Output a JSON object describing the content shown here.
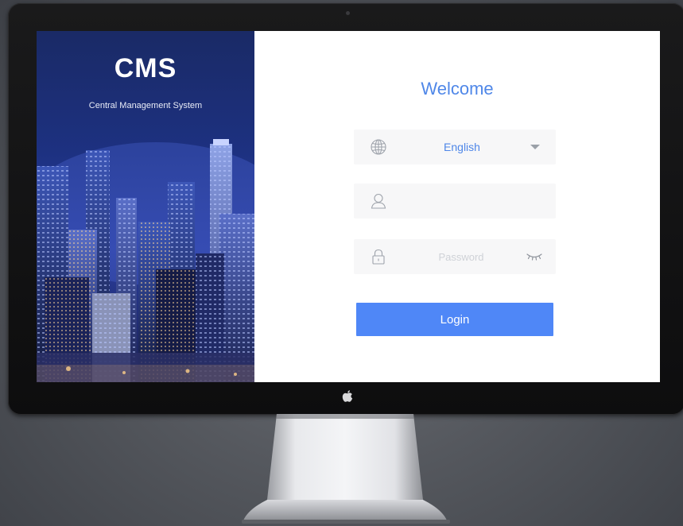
{
  "brand": {
    "title": "CMS",
    "subtitle": "Central Management System"
  },
  "login": {
    "welcome": "Welcome",
    "language": {
      "selected": "English",
      "icon": "globe-icon"
    },
    "username": {
      "value": "",
      "placeholder": "",
      "icon": "user-icon"
    },
    "password": {
      "value": "",
      "placeholder": "Password",
      "icon": "lock-icon",
      "toggle_icon": "eye-closed-icon"
    },
    "submit_label": "Login"
  },
  "colors": {
    "accent": "#4f87f7",
    "welcome_text": "#4f87e8",
    "field_background": "#f7f7f8",
    "brand_panel": "#1d3181",
    "monitor_bezel": "#111112",
    "backdrop": "#55585e"
  },
  "device": {
    "logo_icon": "apple-logo-icon"
  }
}
